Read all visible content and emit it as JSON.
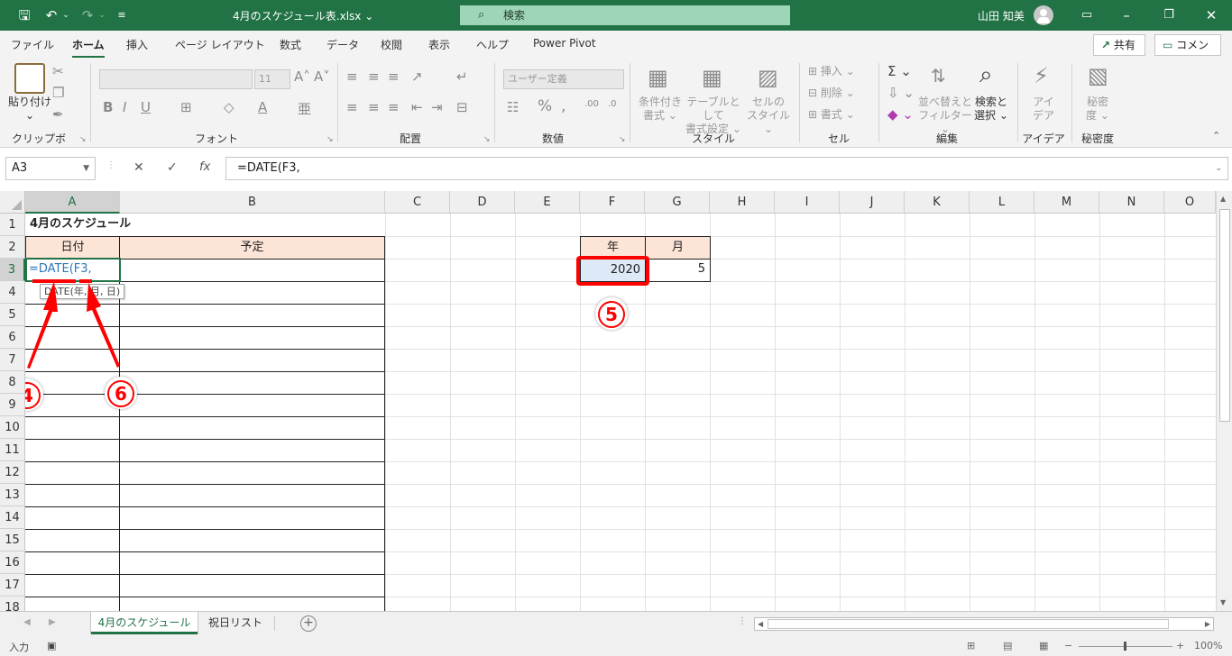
{
  "titlebar": {
    "filename": "4月のスケジュール表.xlsx",
    "search": "検索",
    "user": "山田 知美"
  },
  "menu": {
    "tabs": [
      "ファイル",
      "ホーム",
      "挿入",
      "ページ レイアウト",
      "数式",
      "データ",
      "校閲",
      "表示",
      "ヘルプ",
      "Power Pivot"
    ],
    "share": "共有",
    "comment": "コメント"
  },
  "ribbon": {
    "clipboard": {
      "paste": "貼り付け",
      "label": "クリップボード"
    },
    "font": {
      "label": "フォント",
      "size": "11"
    },
    "alignment": {
      "label": "配置"
    },
    "number": {
      "label": "数値",
      "format": "ユーザー定義"
    },
    "styles": {
      "label": "スタイル",
      "cond_line1": "条件付き",
      "cond_line2": "書式",
      "table_line1": "テーブルとして",
      "table_line2": "書式設定",
      "cell_line1": "セルの",
      "cell_line2": "スタイル"
    },
    "cells": {
      "label": "セル",
      "insert": "挿入",
      "delete": "削除",
      "format": "書式"
    },
    "editing": {
      "label": "編集",
      "sort_line1": "並べ替えと",
      "sort_line2": "フィルター",
      "find_line1": "検索と",
      "find_line2": "選択"
    },
    "ideas": {
      "label": "アイデア",
      "line1": "アイ",
      "line2": "デア"
    },
    "sensitivity": {
      "label": "秘密度",
      "line1": "秘密",
      "line2": "度"
    }
  },
  "formula_bar": {
    "name_box": "A3",
    "formula": "=DATE(F3,"
  },
  "columns": [
    "A",
    "B",
    "C",
    "D",
    "E",
    "F",
    "G",
    "H",
    "I",
    "J",
    "K",
    "L",
    "M",
    "N",
    "O"
  ],
  "rows": [
    "1",
    "2",
    "3",
    "4",
    "5",
    "6",
    "7",
    "8",
    "9",
    "10",
    "11",
    "12",
    "13",
    "14",
    "15",
    "16",
    "17",
    "18"
  ],
  "sheet": {
    "a1": "4月のスケジュール",
    "a2": "日付",
    "b2": "予定",
    "a3": "=DATE(F3,",
    "tooltip": "DATE(年, 月, 日)",
    "f2": "年",
    "g2": "月",
    "f3": "2020",
    "g3": "5"
  },
  "annotations": {
    "step4": "4",
    "step5": "5",
    "step6": "6",
    "color": "#ff0000"
  },
  "sheet_tabs": [
    "4月のスケジュール",
    "祝日リスト"
  ],
  "status": {
    "mode": "入力",
    "zoom": "100%"
  },
  "colors": {
    "accent": "#217346",
    "header_fill": "#fce4d6",
    "selection_fill": "#dde9f7"
  }
}
